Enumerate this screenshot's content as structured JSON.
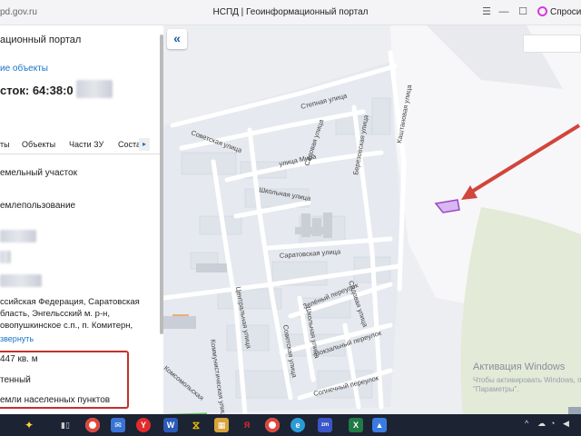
{
  "browser": {
    "url": "pd.gov.ru",
    "title": "НСПД | Геоинформационный портал",
    "ask": "Спросить",
    "icons": [
      "bookmark-icon",
      "minimize-icon",
      "maximize-icon",
      "close-icon"
    ]
  },
  "panel": {
    "title": "ационный портал",
    "link": "ие объекты",
    "cadastral": "сток: 64:38:0",
    "tabs": [
      "ты",
      "Объекты",
      "Части ЗУ",
      "Соста"
    ],
    "rows": [
      "емельный участок",
      "емлепользование"
    ],
    "address": [
      "ссийская Федерация, Саратовская",
      "бласть, Энгельсский м. р-н,",
      "овопушкинское с.п., п. Комитерн,"
    ],
    "expand": "звернуть",
    "area": "447 кв. м",
    "status": "тенный",
    "category": "емли населенных пунктов"
  },
  "map": {
    "collapse_label": "«",
    "streets": [
      "Степная улица",
      "Садовая улица",
      "Березовская улица",
      "Каштановая улица",
      "Советская улица",
      "улица Мира",
      "Школьная улица",
      "Саратовская улица",
      "Центральная улица",
      "Зелёный переулок",
      "Садовая улица",
      "Школьная улица",
      "Советская улица",
      "Вокзальный переулок",
      "Солнечный переулок",
      "Коммунистическая улица",
      "Комсомольская"
    ],
    "watermark": {
      "title": "Активация Windows",
      "line1": "Чтобы активировать Windows, п",
      "line2": "\"Параметры\"."
    },
    "colors": {
      "arrow": "#d2453a",
      "parcel": "#a046c8",
      "green": "#6fcf5a"
    }
  },
  "taskbar": {
    "apps": [
      "W",
      "X"
    ],
    "tray": "^"
  }
}
